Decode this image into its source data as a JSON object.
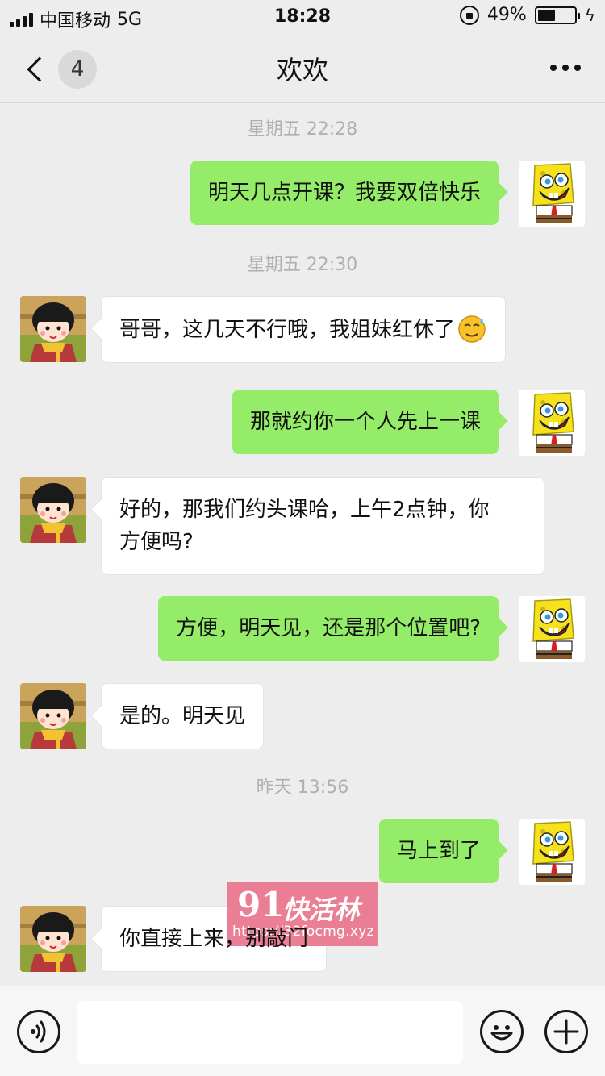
{
  "status_bar": {
    "carrier": "中国移动",
    "network": "5G",
    "time": "18:28",
    "battery_percent": "49%",
    "battery_level": 0.49
  },
  "nav": {
    "unread_count": "4",
    "title": "欢欢"
  },
  "timestamps": [
    "星期五 22:28",
    "星期五 22:30",
    "昨天 13:56"
  ],
  "messages": [
    {
      "side": "out",
      "text": "明天几点开课？我要双倍快乐"
    },
    {
      "side": "in",
      "text": "哥哥，这几天不行哦，我姐妹红休了",
      "emoji": "sweat-smile-emoji"
    },
    {
      "side": "out",
      "text": "那就约你一个人先上一课"
    },
    {
      "side": "in",
      "text_lines": [
        "好的，那我们约头课哈，上午2点钟，你",
        "方便吗?"
      ]
    },
    {
      "side": "out",
      "text": "方便，明天见，还是那个位置吧?"
    },
    {
      "side": "in",
      "text": "是的。明天见"
    },
    {
      "side": "out",
      "text": "马上到了"
    },
    {
      "side": "in",
      "text": "你直接上来，别敲门"
    }
  ],
  "watermark": {
    "number": "91",
    "name": "快活林",
    "url": "https://32focmg.xyz"
  },
  "input_bar": {
    "icons": [
      "voice-icon",
      "emoji-face-icon",
      "plus-icon"
    ]
  },
  "colors": {
    "background": "#ededed",
    "outgoing_bubble": "#95ec69",
    "incoming_bubble": "#ffffff",
    "watermark": "#e9748c"
  }
}
